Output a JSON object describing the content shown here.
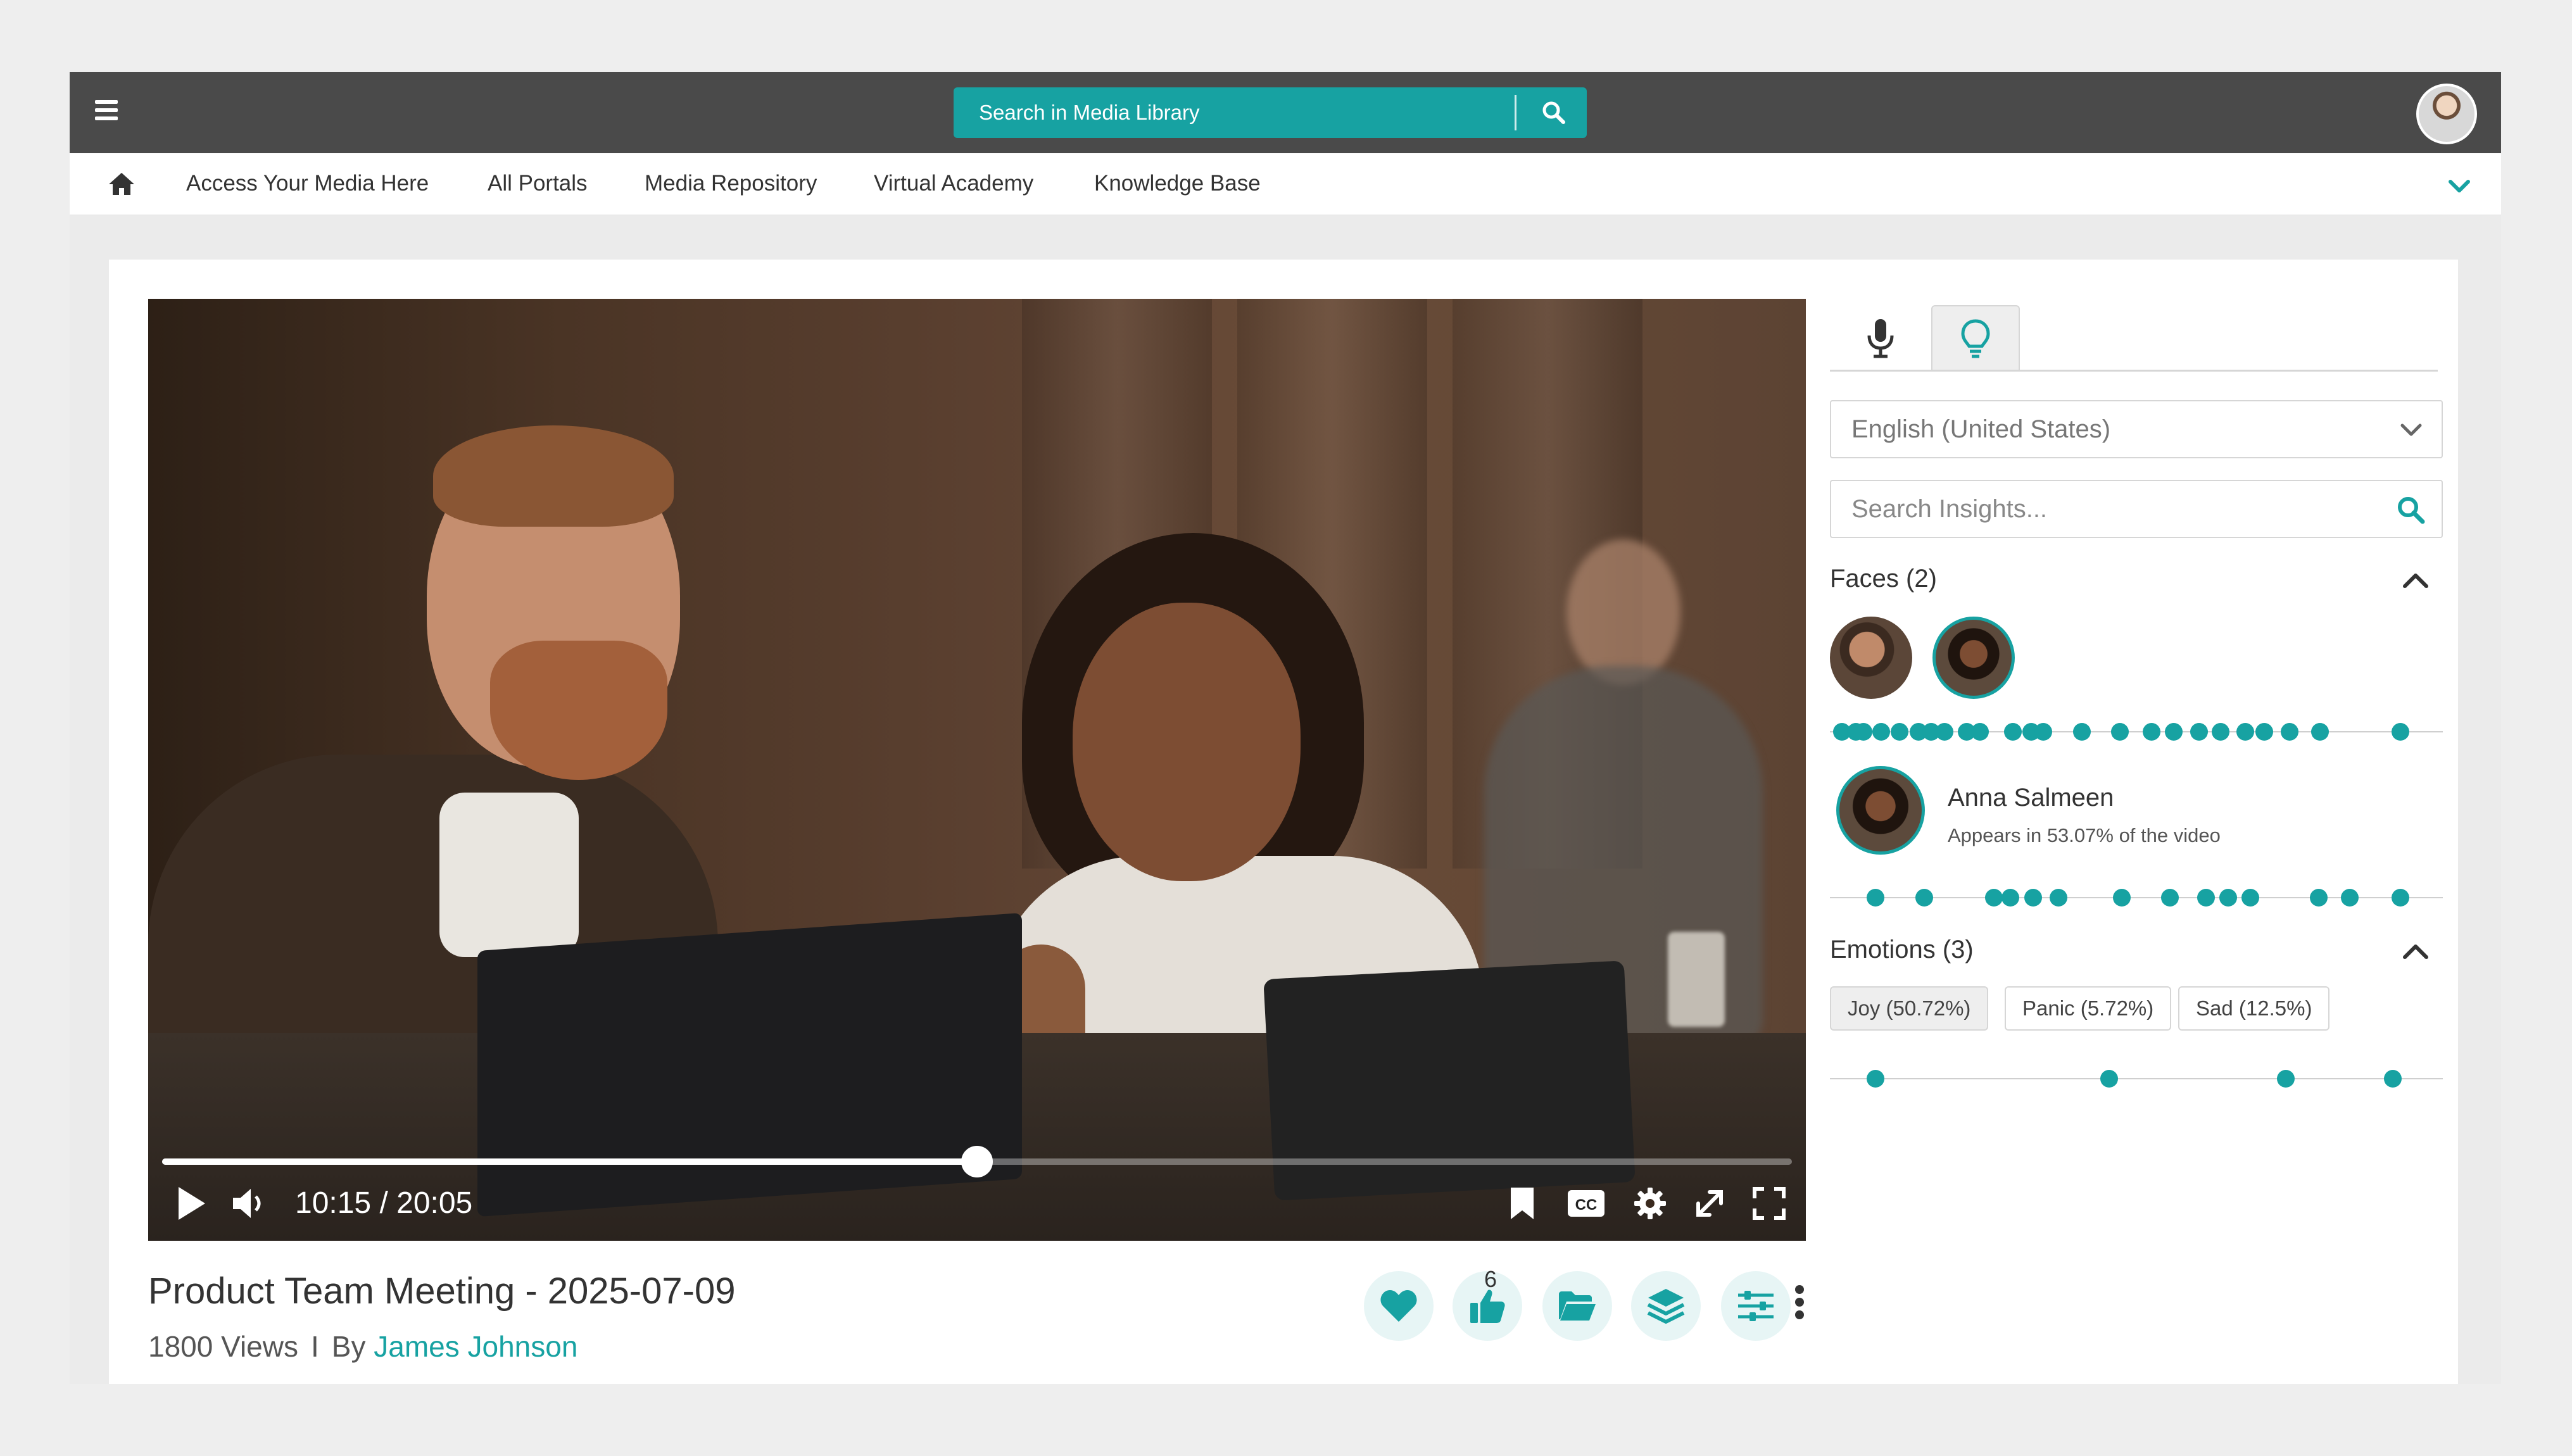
{
  "header": {
    "search_placeholder": "Search in Media Library"
  },
  "nav": {
    "items": [
      "Access Your Media Here",
      "All Portals",
      "Media Repository",
      "Virtual Academy",
      "Knowledge Base"
    ]
  },
  "player": {
    "time": "10:15 / 20:05",
    "progress": 0.5
  },
  "video_info": {
    "title": "Product Team Meeting - 2025-07-09",
    "views": "1800 Views",
    "separator": "I",
    "by": "By",
    "author": "James Johnson",
    "like_count": "6"
  },
  "insights": {
    "language": "English (United States)",
    "search_placeholder": "Search Insights...",
    "faces_title": "Faces (2)",
    "faces_timeline": [
      0.5,
      2.9,
      4.2,
      7.1,
      10.2,
      13.4,
      15.5,
      17.8,
      21.5,
      23.7,
      29.3,
      32.3,
      34.4,
      40.9,
      47.2,
      52.6,
      56.3,
      60.5,
      64.1,
      68.3,
      71.5,
      75.7,
      80.9,
      94.4
    ],
    "selected_person": {
      "name": "Anna Salmeen",
      "subtitle": "Appears in 53.07% of the video"
    },
    "person_timeline": [
      6.2,
      14.4,
      26.1,
      28.8,
      32.7,
      36.9,
      47.5,
      55.6,
      61.7,
      65.4,
      69.2,
      80.6,
      85.8,
      94.4
    ],
    "emotions_title": "Emotions (3)",
    "emotions": [
      "Joy (50.72%)",
      "Panic (5.72%)",
      "Sad (12.5%)"
    ],
    "emotions_timeline": [
      6.2,
      45.4,
      75.1,
      93.1
    ]
  },
  "colors": {
    "accent": "#17a2a2",
    "topbar": "#4a4a4a"
  }
}
